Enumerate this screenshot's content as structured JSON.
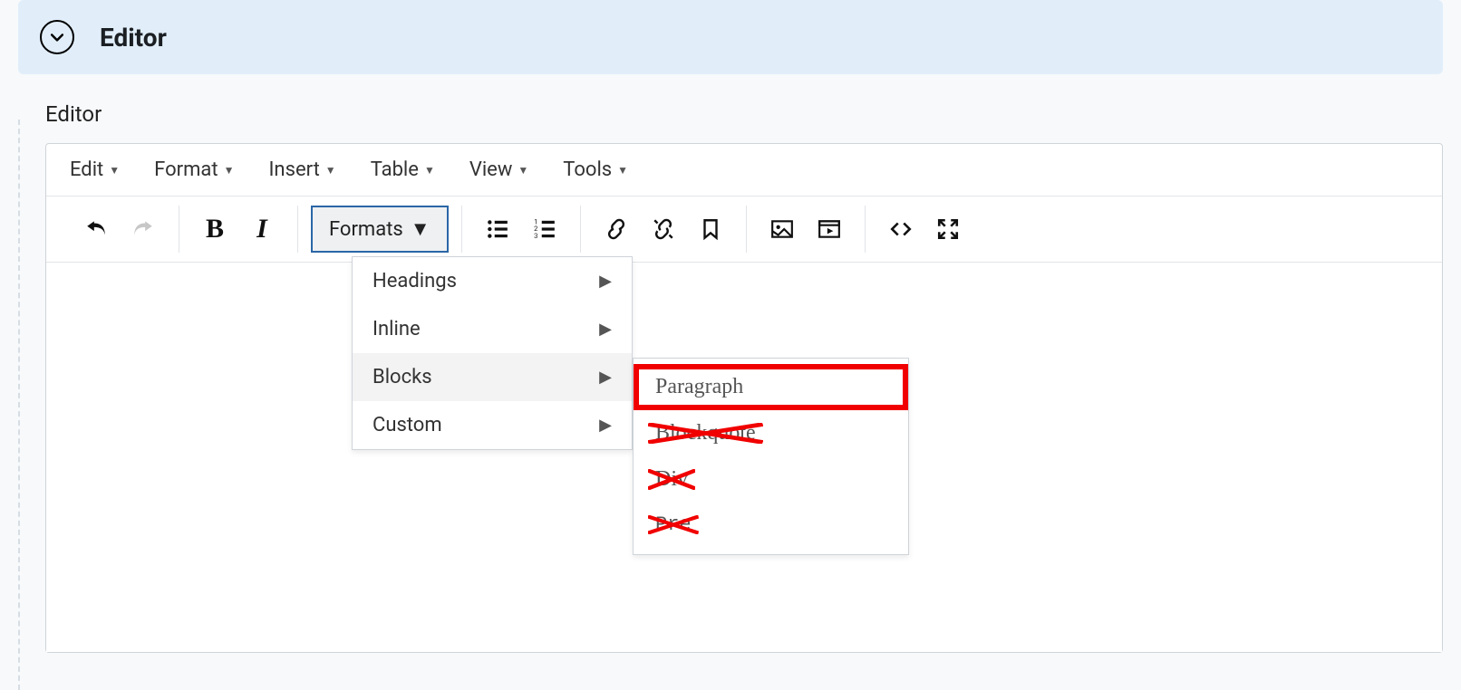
{
  "accordion": {
    "title": "Editor"
  },
  "label": "Editor",
  "menubar": {
    "items": [
      {
        "label": "Edit"
      },
      {
        "label": "Format"
      },
      {
        "label": "Insert"
      },
      {
        "label": "Table"
      },
      {
        "label": "View"
      },
      {
        "label": "Tools"
      }
    ]
  },
  "toolbar": {
    "formats_label": "Formats",
    "bold_glyph": "B",
    "italic_glyph": "I"
  },
  "formats_dropdown": {
    "items": [
      {
        "label": "Headings",
        "highlight": false
      },
      {
        "label": "Inline",
        "highlight": false
      },
      {
        "label": "Blocks",
        "highlight": true
      },
      {
        "label": "Custom",
        "highlight": false
      }
    ]
  },
  "blocks_submenu": {
    "items": [
      {
        "label": "Paragraph",
        "state": "boxed"
      },
      {
        "label": "Blockquote",
        "state": "crossed"
      },
      {
        "label": "Div",
        "state": "crossed"
      },
      {
        "label": "Pre",
        "state": "crossed"
      }
    ]
  },
  "annotation_color": "#f10000"
}
